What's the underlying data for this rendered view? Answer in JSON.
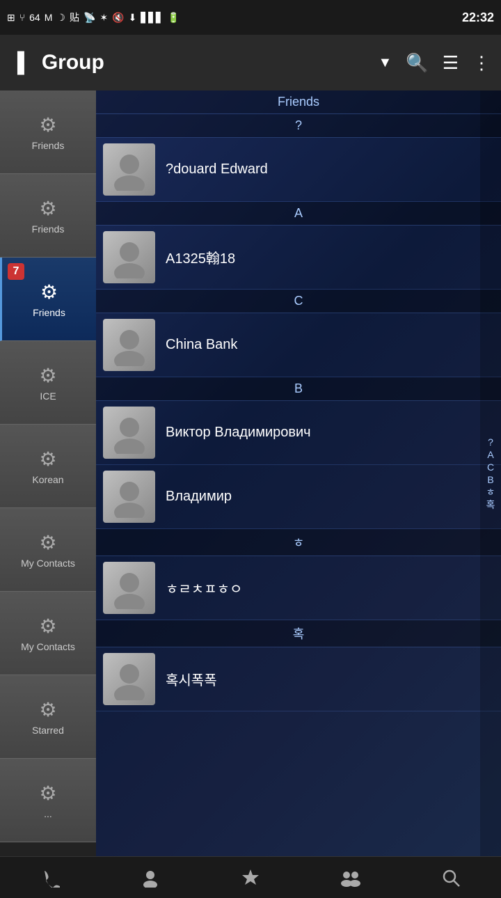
{
  "statusBar": {
    "time": "22:32",
    "leftIcons": [
      "+",
      "USB",
      "64",
      "M",
      "☽",
      "貼",
      "📡",
      "✶",
      "🔇",
      "📶",
      "🔋"
    ]
  },
  "actionBar": {
    "title": "Group",
    "menuIcon": "≡",
    "searchIcon": "🔍",
    "sortIcon": "≡",
    "moreIcon": "⋮"
  },
  "sidebar": {
    "items": [
      {
        "label": "Friends",
        "active": false,
        "badge": null
      },
      {
        "label": "Friends",
        "active": false,
        "badge": null
      },
      {
        "label": "Friends",
        "active": true,
        "badge": "7"
      },
      {
        "label": "ICE",
        "active": false,
        "badge": null
      },
      {
        "label": "Korean",
        "active": false,
        "badge": null
      },
      {
        "label": "My Contacts",
        "active": false,
        "badge": null
      },
      {
        "label": "My Contacts",
        "active": false,
        "badge": null
      },
      {
        "label": "Starred",
        "active": false,
        "badge": null
      },
      {
        "label": "...",
        "active": false,
        "badge": null
      }
    ]
  },
  "contacts": {
    "groupTitle": "Friends",
    "sections": [
      {
        "letter": "?",
        "contacts": [
          {
            "name": "?douard Edward"
          }
        ]
      },
      {
        "letter": "A",
        "contacts": [
          {
            "name": "A1325翰18"
          }
        ]
      },
      {
        "letter": "C",
        "contacts": [
          {
            "name": "China Bank"
          }
        ]
      },
      {
        "letter": "B",
        "contacts": [
          {
            "name": "Виктор Владимирович"
          },
          {
            "name": "Владимир"
          }
        ]
      },
      {
        "letter": "ㅎ",
        "contacts": [
          {
            "name": "ㅎㄹㅊㅍㅎㅇ"
          }
        ]
      },
      {
        "letter": "혹",
        "contacts": [
          {
            "name": "혹시폭폭"
          }
        ]
      }
    ],
    "alphaIndex": [
      "?",
      "A",
      "C",
      "B",
      "ㅎ",
      "혹"
    ]
  },
  "bottomNav": {
    "phone": "📞",
    "contacts": "👤",
    "favorites": "★",
    "groups": "👥",
    "search": "🔍"
  }
}
